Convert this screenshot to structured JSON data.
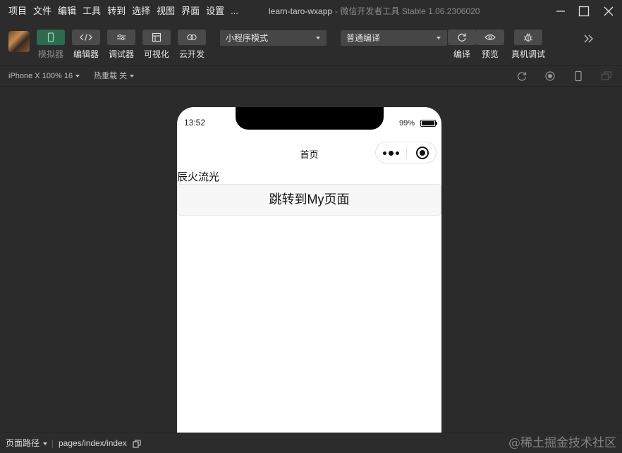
{
  "menu": [
    "项目",
    "文件",
    "编辑",
    "工具",
    "转到",
    "选择",
    "视图",
    "界面",
    "设置",
    "..."
  ],
  "window": {
    "title": "learn-taro-wxapp",
    "subtitle": "- 微信开发者工具 Stable 1.06.2306020"
  },
  "toolbar": {
    "tools": [
      "模拟器",
      "编辑器",
      "调试器",
      "可视化",
      "云开发"
    ],
    "mode_select": "小程序模式",
    "compile_select": "普通编译",
    "actions": [
      "编译",
      "预览",
      "真机调试"
    ]
  },
  "devbar": {
    "device": "iPhone X 100% 16",
    "hot_reload": "热重载 关"
  },
  "phone": {
    "time": "13:52",
    "battery": "99%",
    "nav_title": "首页",
    "text": "辰火流光",
    "button_label": "跳转到My页面"
  },
  "footer": {
    "page_path_label": "页面路径",
    "page_path": "pages/index/index",
    "watermark": "@稀土掘金技术社区"
  },
  "colors": {
    "accent_active": "#2e6b4f",
    "app_bg": "#2b2b2b"
  }
}
